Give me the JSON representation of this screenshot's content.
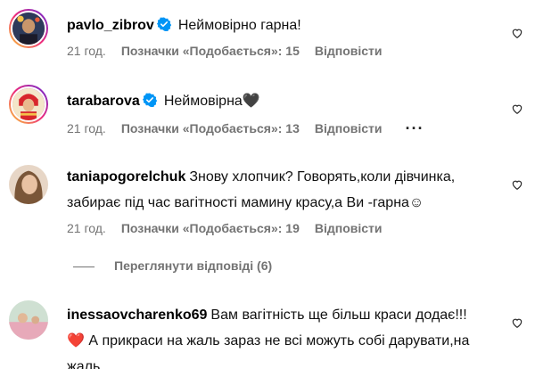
{
  "comments": [
    {
      "username": "pavlo_zibrov",
      "verified": true,
      "text": "Неймовірно гарна!",
      "time": "21 год.",
      "likes": "Позначки «Подобається»: 15",
      "reply": "Відповісти"
    },
    {
      "username": "tarabarova",
      "verified": true,
      "text": "Неймовірна🖤",
      "time": "21 год.",
      "likes": "Позначки «Подобається»: 13",
      "reply": "Відповісти",
      "more": "···"
    },
    {
      "username": "taniapogorelchuk",
      "verified": false,
      "text_line1": "Знову хлопчик? Говорять,коли дівчинка,",
      "text_line2": "забирає під час вагітності мамину красу,а Ви -гарна☺",
      "time": "21 год.",
      "likes": "Позначки «Подобається»: 19",
      "reply": "Відповісти"
    },
    {
      "username": "inessaovcharenko69",
      "verified": false,
      "text_line1": "Вам вагітність ще більш краси додає!!!",
      "text_line2": "❤️ А прикраси на жаль зараз не всі можуть собі дарувати,на",
      "text_line3": "жаль..."
    }
  ],
  "view_replies": "Переглянути відповіді (6)",
  "colors": {
    "meta": "#737373",
    "verified": "#0095f6"
  },
  "icons": [
    "verified-badge-icon",
    "heart-outline-icon",
    "more-options-icon"
  ]
}
